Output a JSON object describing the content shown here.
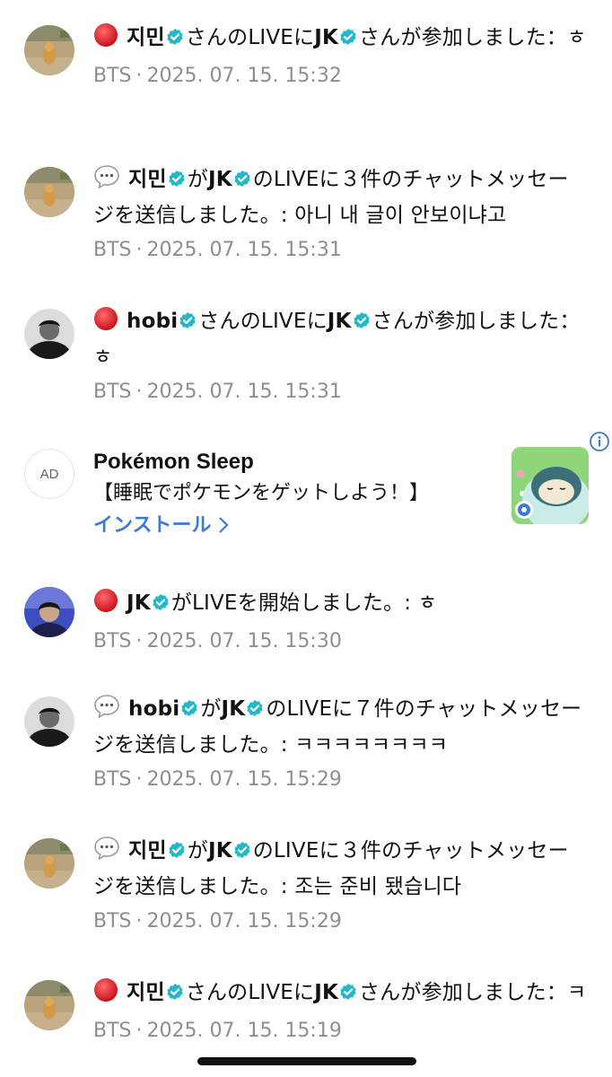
{
  "colors": {
    "accent_blue": "#3a7bd5",
    "verified": "#22b8c9",
    "meta_gray": "#8e8e8e",
    "live_red": "#e02020"
  },
  "notifications": [
    {
      "type": "live-join",
      "icon": "red-circle-icon",
      "avatar": "avatar-jimin-dog",
      "parts": [
        {
          "t": "지민",
          "bold": true,
          "verified": true
        },
        {
          "t": "さんのLIVEに"
        },
        {
          "t": "JK",
          "bold": true,
          "verified": true
        },
        {
          "t": "さんが参加しました：ㅎ"
        }
      ],
      "source": "BTS",
      "separator": "·",
      "timestamp": "2025. 07. 15. 15:32"
    },
    {
      "type": "chat",
      "icon": "speech-bubble-icon",
      "avatar": "avatar-jimin-dog",
      "parts": [
        {
          "t": "지민",
          "bold": true,
          "verified": true
        },
        {
          "t": "が"
        },
        {
          "t": "JK",
          "bold": true,
          "verified": true
        },
        {
          "t": "のLIVEに３件のチャットメッセージを送信しました。: 아니 내 글이 안보이냐고"
        }
      ],
      "source": "BTS",
      "separator": "·",
      "timestamp": "2025. 07. 15. 15:31"
    },
    {
      "type": "live-join",
      "icon": "red-circle-icon",
      "avatar": "avatar-hobi",
      "parts": [
        {
          "t": "hobi",
          "bold": true,
          "verified": true
        },
        {
          "t": "さんのLIVEに"
        },
        {
          "t": "JK",
          "bold": true,
          "verified": true
        },
        {
          "t": "さんが参加しました：ㅎ"
        }
      ],
      "source": "BTS",
      "separator": "·",
      "timestamp": "2025. 07. 15. 15:31"
    },
    {
      "type": "live-start",
      "icon": "red-circle-icon",
      "avatar": "avatar-jk",
      "parts": [
        {
          "t": "JK",
          "bold": true,
          "verified": true
        },
        {
          "t": "がLIVEを開始しました。: ㅎ"
        }
      ],
      "source": "BTS",
      "separator": "·",
      "timestamp": "2025. 07. 15. 15:30"
    },
    {
      "type": "chat",
      "icon": "speech-bubble-icon",
      "avatar": "avatar-hobi",
      "parts": [
        {
          "t": "hobi",
          "bold": true,
          "verified": true
        },
        {
          "t": "が"
        },
        {
          "t": "JK",
          "bold": true,
          "verified": true
        },
        {
          "t": "のLIVEに７件のチャットメッセージを送信しました。: ㅋㅋㅋㅋㅋㅋㅋㅋ"
        }
      ],
      "source": "BTS",
      "separator": "·",
      "timestamp": "2025. 07. 15. 15:29"
    },
    {
      "type": "chat",
      "icon": "speech-bubble-icon",
      "avatar": "avatar-jimin-dog",
      "parts": [
        {
          "t": "지민",
          "bold": true,
          "verified": true
        },
        {
          "t": "が"
        },
        {
          "t": "JK",
          "bold": true,
          "verified": true
        },
        {
          "t": "のLIVEに３件のチャットメッセージを送信しました。: 조는 준비 됐습니다"
        }
      ],
      "source": "BTS",
      "separator": "·",
      "timestamp": "2025. 07. 15. 15:29"
    },
    {
      "type": "live-join",
      "icon": "red-circle-icon",
      "avatar": "avatar-jimin-dog",
      "parts": [
        {
          "t": "지민",
          "bold": true,
          "verified": true
        },
        {
          "t": "さんのLIVEに"
        },
        {
          "t": "JK",
          "bold": true,
          "verified": true
        },
        {
          "t": "さんが参加しました：ㅋ"
        }
      ],
      "source": "BTS",
      "separator": "·",
      "timestamp": "2025. 07. 15. 15:19"
    }
  ],
  "ad": {
    "badge": "AD",
    "title": "Pokémon Sleep",
    "description": "【睡眠でポケモンをゲットしよう！】",
    "cta": "インストール",
    "cta_icon": "chevron-right-icon",
    "info_icon": "info-icon",
    "image": "snorlax-app-icon"
  }
}
